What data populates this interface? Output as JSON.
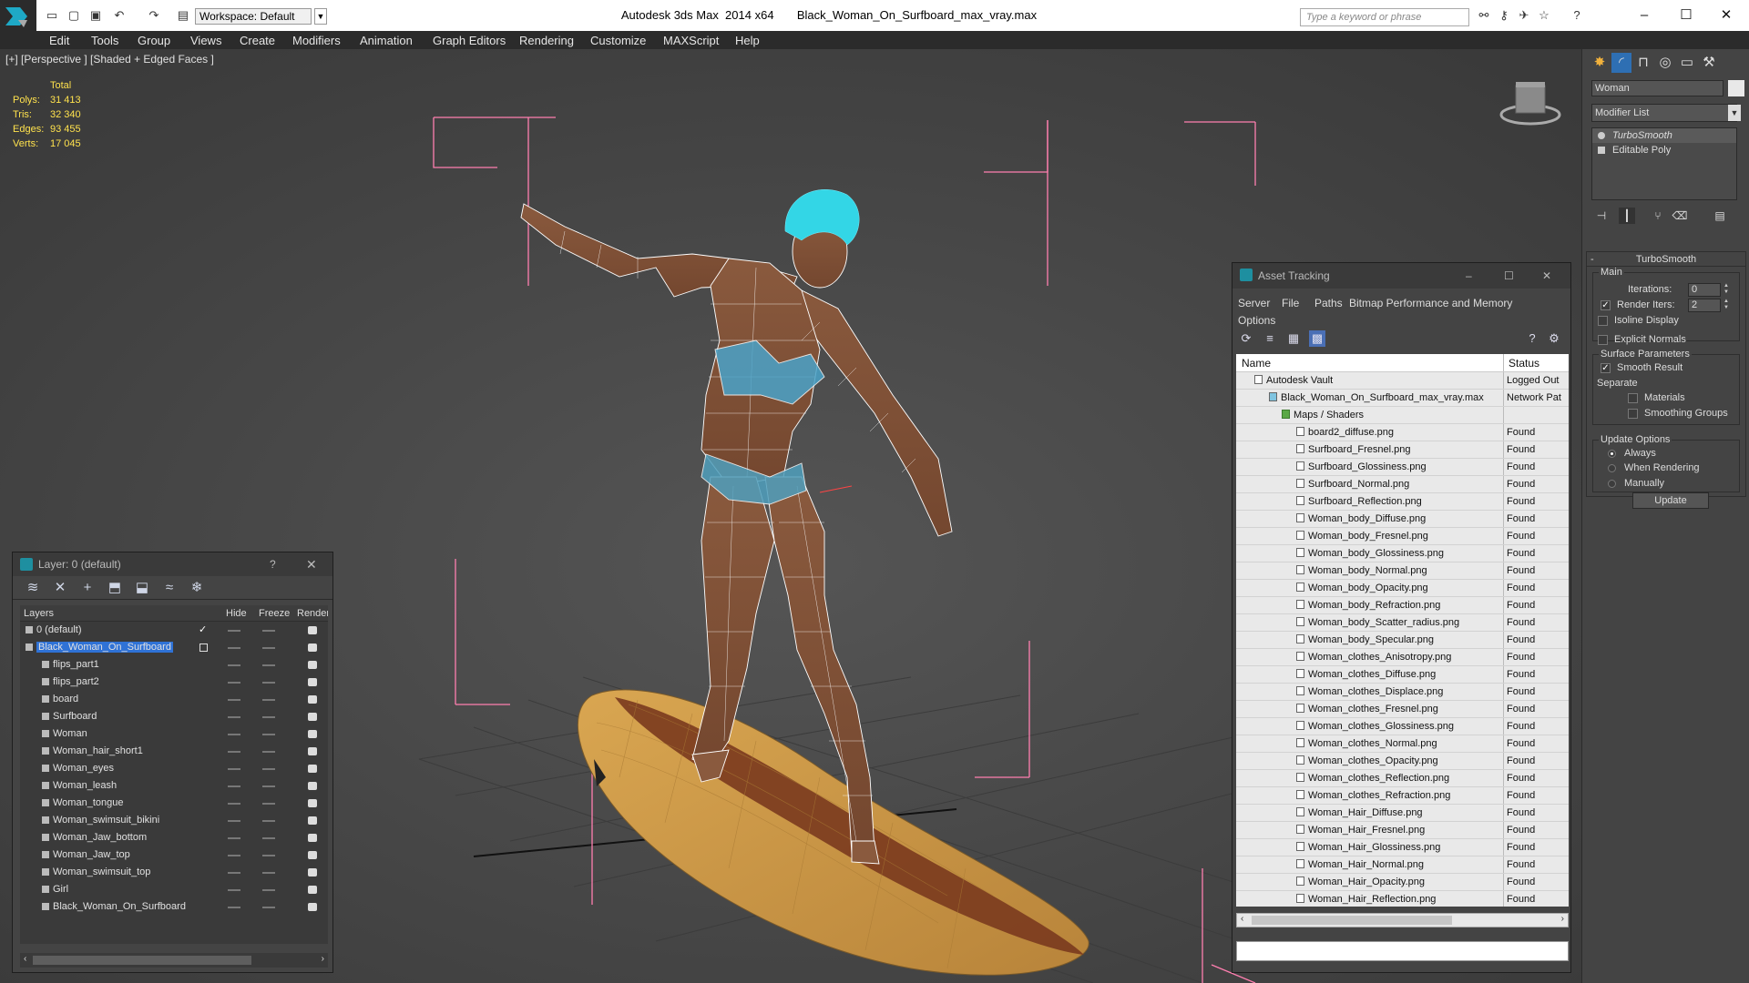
{
  "title_bar": {
    "workspace": "Workspace: Default",
    "title": "Autodesk 3ds Max  2014 x64       Black_Woman_On_Surfboard_max_vray.max",
    "search_placeholder": "Type a keyword or phrase"
  },
  "menu": [
    "Edit",
    "Tools",
    "Group",
    "Views",
    "Create",
    "Modifiers",
    "Animation",
    "Graph Editors",
    "Rendering",
    "Customize",
    "MAXScript",
    "Help"
  ],
  "viewport": {
    "label": "[+] [Perspective ] [Shaded + Edged Faces ]",
    "stats": {
      "header": "Total",
      "rows": [
        {
          "label": "Polys:",
          "value": "31 413"
        },
        {
          "label": "Tris:",
          "value": "32 340"
        },
        {
          "label": "Edges:",
          "value": "93 455"
        },
        {
          "label": "Verts:",
          "value": "17 045"
        }
      ]
    }
  },
  "layer_window": {
    "title": "Layer: 0 (default)",
    "help": "?",
    "close": "✕",
    "columns": [
      "Layers",
      "Hide",
      "Freeze",
      "Render"
    ],
    "rows": [
      {
        "name": "0 (default)",
        "level": 1
      },
      {
        "name": "Black_Woman_On_Surfboard",
        "level": 1,
        "selected": true
      },
      {
        "name": "flips_part1",
        "level": 2
      },
      {
        "name": "flips_part2",
        "level": 2
      },
      {
        "name": "board",
        "level": 2
      },
      {
        "name": "Surfboard",
        "level": 2
      },
      {
        "name": "Woman",
        "level": 2
      },
      {
        "name": "Woman_hair_short1",
        "level": 2
      },
      {
        "name": "Woman_eyes",
        "level": 2
      },
      {
        "name": "Woman_leash",
        "level": 2
      },
      {
        "name": "Woman_tongue",
        "level": 2
      },
      {
        "name": "Woman_swimsuit_bikini",
        "level": 2
      },
      {
        "name": "Woman_Jaw_bottom",
        "level": 2
      },
      {
        "name": "Woman_Jaw_top",
        "level": 2
      },
      {
        "name": "Woman_swimsuit_top",
        "level": 2
      },
      {
        "name": "Girl",
        "level": 2
      },
      {
        "name": "Black_Woman_On_Surfboard",
        "level": 2
      }
    ]
  },
  "asset_window": {
    "title": "Asset Tracking",
    "menu": [
      "Server",
      "File",
      "Paths",
      "Bitmap Performance and Memory",
      "Options"
    ],
    "columns": [
      "Name",
      "Status"
    ],
    "rows": [
      {
        "name": "Autodesk Vault",
        "status": "Logged Out",
        "level": 1
      },
      {
        "name": "Black_Woman_On_Surfboard_max_vray.max",
        "status": "Network Pat",
        "level": 2
      },
      {
        "name": "Maps / Shaders",
        "status": "",
        "level": 3
      },
      {
        "name": "board2_diffuse.png",
        "status": "Found",
        "level": 4
      },
      {
        "name": "Surfboard_Fresnel.png",
        "status": "Found",
        "level": 4
      },
      {
        "name": "Surfboard_Glossiness.png",
        "status": "Found",
        "level": 4
      },
      {
        "name": "Surfboard_Normal.png",
        "status": "Found",
        "level": 4
      },
      {
        "name": "Surfboard_Reflection.png",
        "status": "Found",
        "level": 4
      },
      {
        "name": "Woman_body_Diffuse.png",
        "status": "Found",
        "level": 4
      },
      {
        "name": "Woman_body_Fresnel.png",
        "status": "Found",
        "level": 4
      },
      {
        "name": "Woman_body_Glossiness.png",
        "status": "Found",
        "level": 4
      },
      {
        "name": "Woman_body_Normal.png",
        "status": "Found",
        "level": 4
      },
      {
        "name": "Woman_body_Opacity.png",
        "status": "Found",
        "level": 4
      },
      {
        "name": "Woman_body_Refraction.png",
        "status": "Found",
        "level": 4
      },
      {
        "name": "Woman_body_Scatter_radius.png",
        "status": "Found",
        "level": 4
      },
      {
        "name": "Woman_body_Specular.png",
        "status": "Found",
        "level": 4
      },
      {
        "name": "Woman_clothes_Anisotropy.png",
        "status": "Found",
        "level": 4
      },
      {
        "name": "Woman_clothes_Diffuse.png",
        "status": "Found",
        "level": 4
      },
      {
        "name": "Woman_clothes_Displace.png",
        "status": "Found",
        "level": 4
      },
      {
        "name": "Woman_clothes_Fresnel.png",
        "status": "Found",
        "level": 4
      },
      {
        "name": "Woman_clothes_Glossiness.png",
        "status": "Found",
        "level": 4
      },
      {
        "name": "Woman_clothes_Normal.png",
        "status": "Found",
        "level": 4
      },
      {
        "name": "Woman_clothes_Opacity.png",
        "status": "Found",
        "level": 4
      },
      {
        "name": "Woman_clothes_Reflection.png",
        "status": "Found",
        "level": 4
      },
      {
        "name": "Woman_clothes_Refraction.png",
        "status": "Found",
        "level": 4
      },
      {
        "name": "Woman_Hair_Diffuse.png",
        "status": "Found",
        "level": 4
      },
      {
        "name": "Woman_Hair_Fresnel.png",
        "status": "Found",
        "level": 4
      },
      {
        "name": "Woman_Hair_Glossiness.png",
        "status": "Found",
        "level": 4
      },
      {
        "name": "Woman_Hair_Normal.png",
        "status": "Found",
        "level": 4
      },
      {
        "name": "Woman_Hair_Opacity.png",
        "status": "Found",
        "level": 4
      },
      {
        "name": "Woman_Hair_Reflection.png",
        "status": "Found",
        "level": 4
      }
    ]
  },
  "command_panel": {
    "object_name": "Woman",
    "modifier_list": "Modifier List",
    "stack": [
      {
        "name": "TurboSmooth",
        "active": true
      },
      {
        "name": "Editable Poly",
        "active": false
      }
    ],
    "turbosmooth": {
      "title": "TurboSmooth",
      "main_group": "Main",
      "iterations_label": "Iterations:",
      "iterations_value": "0",
      "render_iters_label": "Render Iters:",
      "render_iters_value": "2",
      "render_iters_checked": true,
      "isoline_label": "Isoline Display",
      "explicit_normals_label": "Explicit Normals",
      "surface_group": "Surface Parameters",
      "smooth_result_label": "Smooth Result",
      "separate_label": "Separate",
      "materials_label": "Materials",
      "smoothing_groups_label": "Smoothing Groups",
      "update_group": "Update Options",
      "always_label": "Always",
      "when_rendering_label": "When Rendering",
      "manually_label": "Manually",
      "update_button": "Update"
    }
  },
  "colors": {
    "viewport_bg": "#4a4a4a",
    "stats_text": "#ffe24d",
    "selection_blue": "#2f72d6",
    "gizmo_pink": "#ff7fb0",
    "hair_cyan": "#33d6e6",
    "board_wood": "#c99443"
  }
}
